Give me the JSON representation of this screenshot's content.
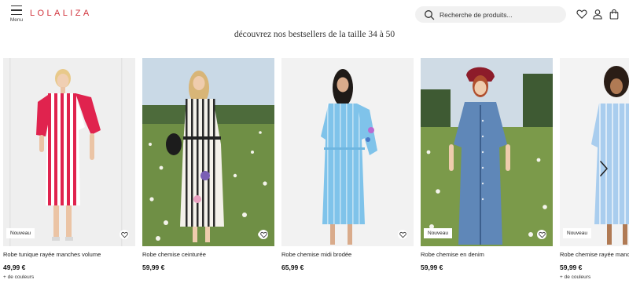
{
  "header": {
    "menu_label": "Menu",
    "logo": "LOLALIZA",
    "search_placeholder": "Recherche de produits..."
  },
  "headline": "découvrez nos bestsellers de la taille 34 à 50",
  "products": [
    {
      "title": "Robe tunique rayée manches volume",
      "price": "49,99 €",
      "badge": "Nouveau",
      "more_colors": "+ de couleurs"
    },
    {
      "title": "Robe chemise ceinturée",
      "price": "59,99 €",
      "badge": "",
      "more_colors": ""
    },
    {
      "title": "Robe chemise midi brodée",
      "price": "65,99 €",
      "badge": "",
      "more_colors": ""
    },
    {
      "title": "Robe chemise en denim",
      "price": "59,99 €",
      "badge": "Nouveau",
      "more_colors": ""
    },
    {
      "title": "Robe chemise rayée manc",
      "price": "59,99 €",
      "badge": "Nouveau",
      "more_colors": "+ de couleurs"
    }
  ],
  "icons": {
    "menu": "hamburger-icon",
    "search": "search-icon",
    "wishlist": "heart-icon",
    "account": "user-icon",
    "cart": "shopping-bag-icon",
    "favorite": "heart-outline-icon",
    "next": "chevron-right-icon"
  },
  "colors": {
    "brand": "#d1323b",
    "search_bg": "#f1f1f1"
  }
}
